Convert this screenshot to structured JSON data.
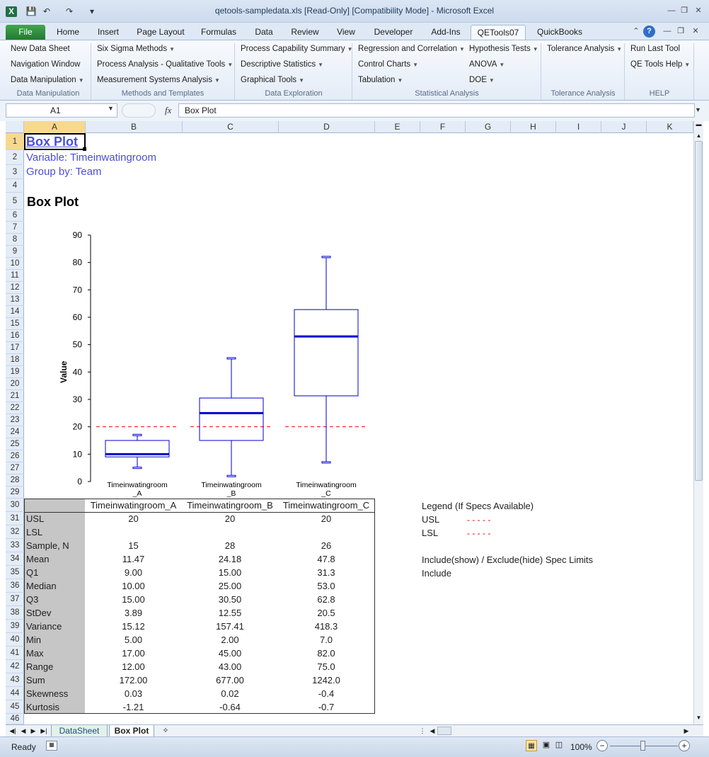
{
  "window": {
    "title": "qetools-sampledata.xls  [Read-Only]  [Compatibility Mode]  -  Microsoft Excel"
  },
  "tabs": [
    "File",
    "Home",
    "Insert",
    "Page Layout",
    "Formulas",
    "Data",
    "Review",
    "View",
    "Developer",
    "Add-Ins",
    "QETools07",
    "QuickBooks"
  ],
  "ribbon": {
    "g1": {
      "items": [
        "New Data Sheet",
        "Navigation Window",
        "Data Manipulation"
      ],
      "label": "Data Manipulation"
    },
    "g2": {
      "items": [
        "Six Sigma Methods",
        "Process Analysis - Qualitative Tools",
        "Measurement Systems Analysis"
      ],
      "label": "Methods and Templates"
    },
    "g3": {
      "items": [
        "Process Capability Summary",
        "Descriptive Statistics",
        "Graphical Tools"
      ],
      "label": "Data Exploration"
    },
    "g4": {
      "items": [
        "Regression and Correlation",
        "Control Charts",
        "Tabulation",
        "Hypothesis Tests",
        "ANOVA",
        "DOE"
      ],
      "label": "Statistical Analysis"
    },
    "g5": {
      "items": [
        "Tolerance Analysis"
      ],
      "label": "Tolerance Analysis"
    },
    "g6": {
      "items": [
        "Run Last Tool",
        "QE Tools Help"
      ],
      "label": "HELP"
    }
  },
  "formula": {
    "name_box": "A1",
    "content": "Box Plot"
  },
  "columns": [
    "A",
    "B",
    "C",
    "D",
    "E",
    "F",
    "G",
    "H",
    "I",
    "J",
    "K"
  ],
  "rows": [
    "1",
    "2",
    "3",
    "4",
    "5",
    "6",
    "7",
    "8",
    "9",
    "10",
    "11",
    "12",
    "13",
    "14",
    "15",
    "16",
    "17",
    "18",
    "19",
    "20",
    "21",
    "22",
    "23",
    "24",
    "25",
    "26",
    "27",
    "28",
    "29",
    "30",
    "31",
    "32",
    "33",
    "34",
    "35",
    "36",
    "37",
    "38",
    "39",
    "40",
    "41",
    "42",
    "43",
    "44",
    "45",
    "46"
  ],
  "sheet": {
    "title": "Box Plot",
    "variable_line": "Variable:  Timeinwatingroom",
    "group_line": "Group by:  Team",
    "chart_heading": "Box Plot"
  },
  "chart_data": {
    "type": "box",
    "ylabel": "Value",
    "ylim": [
      0,
      90
    ],
    "yticks": [
      0,
      10,
      20,
      30,
      40,
      50,
      60,
      70,
      80,
      90
    ],
    "usl": 20,
    "usl_color": "#ff0000",
    "box_color": "#0000cc",
    "groups": [
      {
        "label1": "Timeinwatingroom",
        "label2": "_A",
        "min": 5,
        "q1": 9,
        "median": 10,
        "q3": 15,
        "max": 17
      },
      {
        "label1": "Timeinwatingroom",
        "label2": "_B",
        "min": 2,
        "q1": 15,
        "median": 25,
        "q3": 30.5,
        "max": 45
      },
      {
        "label1": "Timeinwatingroom",
        "label2": "_C",
        "min": 7,
        "q1": 31.3,
        "median": 53,
        "q3": 62.8,
        "max": 82
      }
    ]
  },
  "stats": {
    "headers": [
      "Timeinwatingroom_A",
      "Timeinwatingroom_B",
      "Timeinwatingroom_C"
    ],
    "rows": [
      {
        "label": "USL",
        "v": [
          "20",
          "20",
          "20"
        ]
      },
      {
        "label": "LSL",
        "v": [
          "",
          "",
          ""
        ]
      },
      {
        "label": "Sample, N",
        "v": [
          "15",
          "28",
          "26"
        ]
      },
      {
        "label": "Mean",
        "v": [
          "11.47",
          "24.18",
          "47.8"
        ]
      },
      {
        "label": "Q1",
        "v": [
          "9.00",
          "15.00",
          "31.3"
        ]
      },
      {
        "label": "Median",
        "v": [
          "10.00",
          "25.00",
          "53.0"
        ]
      },
      {
        "label": "Q3",
        "v": [
          "15.00",
          "30.50",
          "62.8"
        ]
      },
      {
        "label": "StDev",
        "v": [
          "3.89",
          "12.55",
          "20.5"
        ]
      },
      {
        "label": "Variance",
        "v": [
          "15.12",
          "157.41",
          "418.3"
        ]
      },
      {
        "label": "Min",
        "v": [
          "5.00",
          "2.00",
          "7.0"
        ]
      },
      {
        "label": "Max",
        "v": [
          "17.00",
          "45.00",
          "82.0"
        ]
      },
      {
        "label": "Range",
        "v": [
          "12.00",
          "43.00",
          "75.0"
        ]
      },
      {
        "label": "Sum",
        "v": [
          "172.00",
          "677.00",
          "1242.0"
        ]
      },
      {
        "label": "Skewness",
        "v": [
          "0.03",
          "0.02",
          "-0.4"
        ]
      },
      {
        "label": "Kurtosis",
        "v": [
          "-1.21",
          "-0.64",
          "-0.7"
        ]
      }
    ]
  },
  "legend": {
    "title": "Legend (If Specs Available)",
    "usl_label": "USL",
    "lsl_label": "LSL",
    "dash": "- - - - -",
    "usl_color": "#ff0000",
    "lsl_color": "#ff0000",
    "include_title": "Include(show) / Exclude(hide) Spec Limits",
    "include_value": "Include"
  },
  "sheet_tabs": [
    "DataSheet",
    "Box Plot"
  ],
  "status": {
    "ready": "Ready",
    "zoom": "100%"
  }
}
